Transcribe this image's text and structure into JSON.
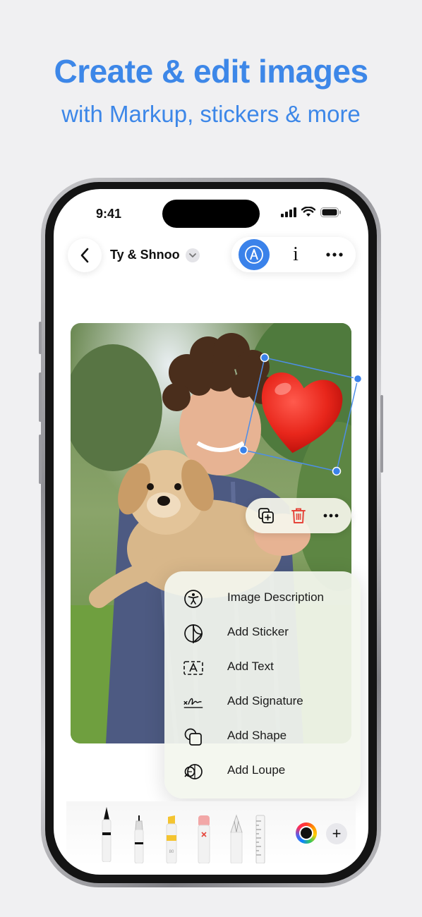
{
  "hero": {
    "title": "Create & edit images",
    "subtitle": "with Markup, stickers & more"
  },
  "status_bar": {
    "time": "9:41"
  },
  "toolbar": {
    "title": "Ty & Shnoo",
    "info_glyph": "i"
  },
  "menu": {
    "items": [
      {
        "label": "Image Description",
        "icon": "accessibility-icon"
      },
      {
        "label": "Add Sticker",
        "icon": "sticker-icon"
      },
      {
        "label": "Add Text",
        "icon": "text-box-icon"
      },
      {
        "label": "Add Signature",
        "icon": "signature-icon"
      },
      {
        "label": "Add Shape",
        "icon": "shape-icon"
      },
      {
        "label": "Add Loupe",
        "icon": "loupe-icon"
      }
    ]
  },
  "tools": {
    "marker_label": "80",
    "add_glyph": "+",
    "current_color": "#111111"
  },
  "colors": {
    "accent": "#3d87e8",
    "markup_active": "#3a82ea",
    "delete_red": "#e5453b"
  }
}
